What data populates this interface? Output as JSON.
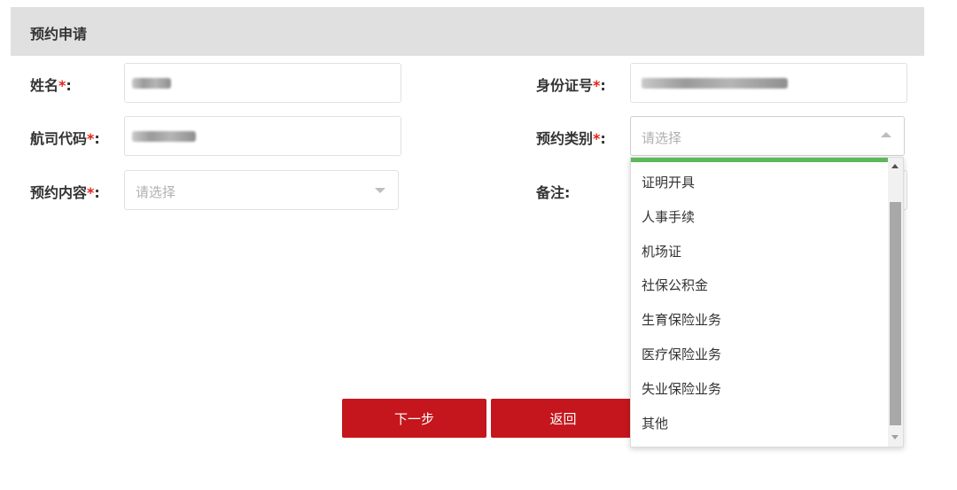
{
  "header": {
    "title": "预约申请"
  },
  "form": {
    "name_label": "姓名",
    "id_label": "身份证号",
    "airline_code_label": "航司代码",
    "category_label": "预约类别",
    "category_placeholder": "请选择",
    "content_label": "预约内容",
    "content_placeholder": "请选择",
    "remark_label": "备注",
    "required_mark": "*",
    "colon": ":"
  },
  "dropdown": {
    "options": [
      "证明开具",
      "人事手续",
      "机场证",
      "社保公积金",
      "生育保险业务",
      "医疗保险业务",
      "失业保险业务",
      "其他"
    ]
  },
  "buttons": {
    "next": "下一步",
    "back": "返回"
  },
  "colors": {
    "primary": "#c4161c",
    "required": "#e2231a",
    "header_bg": "#e0e0e0",
    "highlight": "#5cb85c"
  },
  "icons": {
    "select_arrow_down": "chevron-down-icon",
    "select_arrow_up": "chevron-up-icon"
  }
}
